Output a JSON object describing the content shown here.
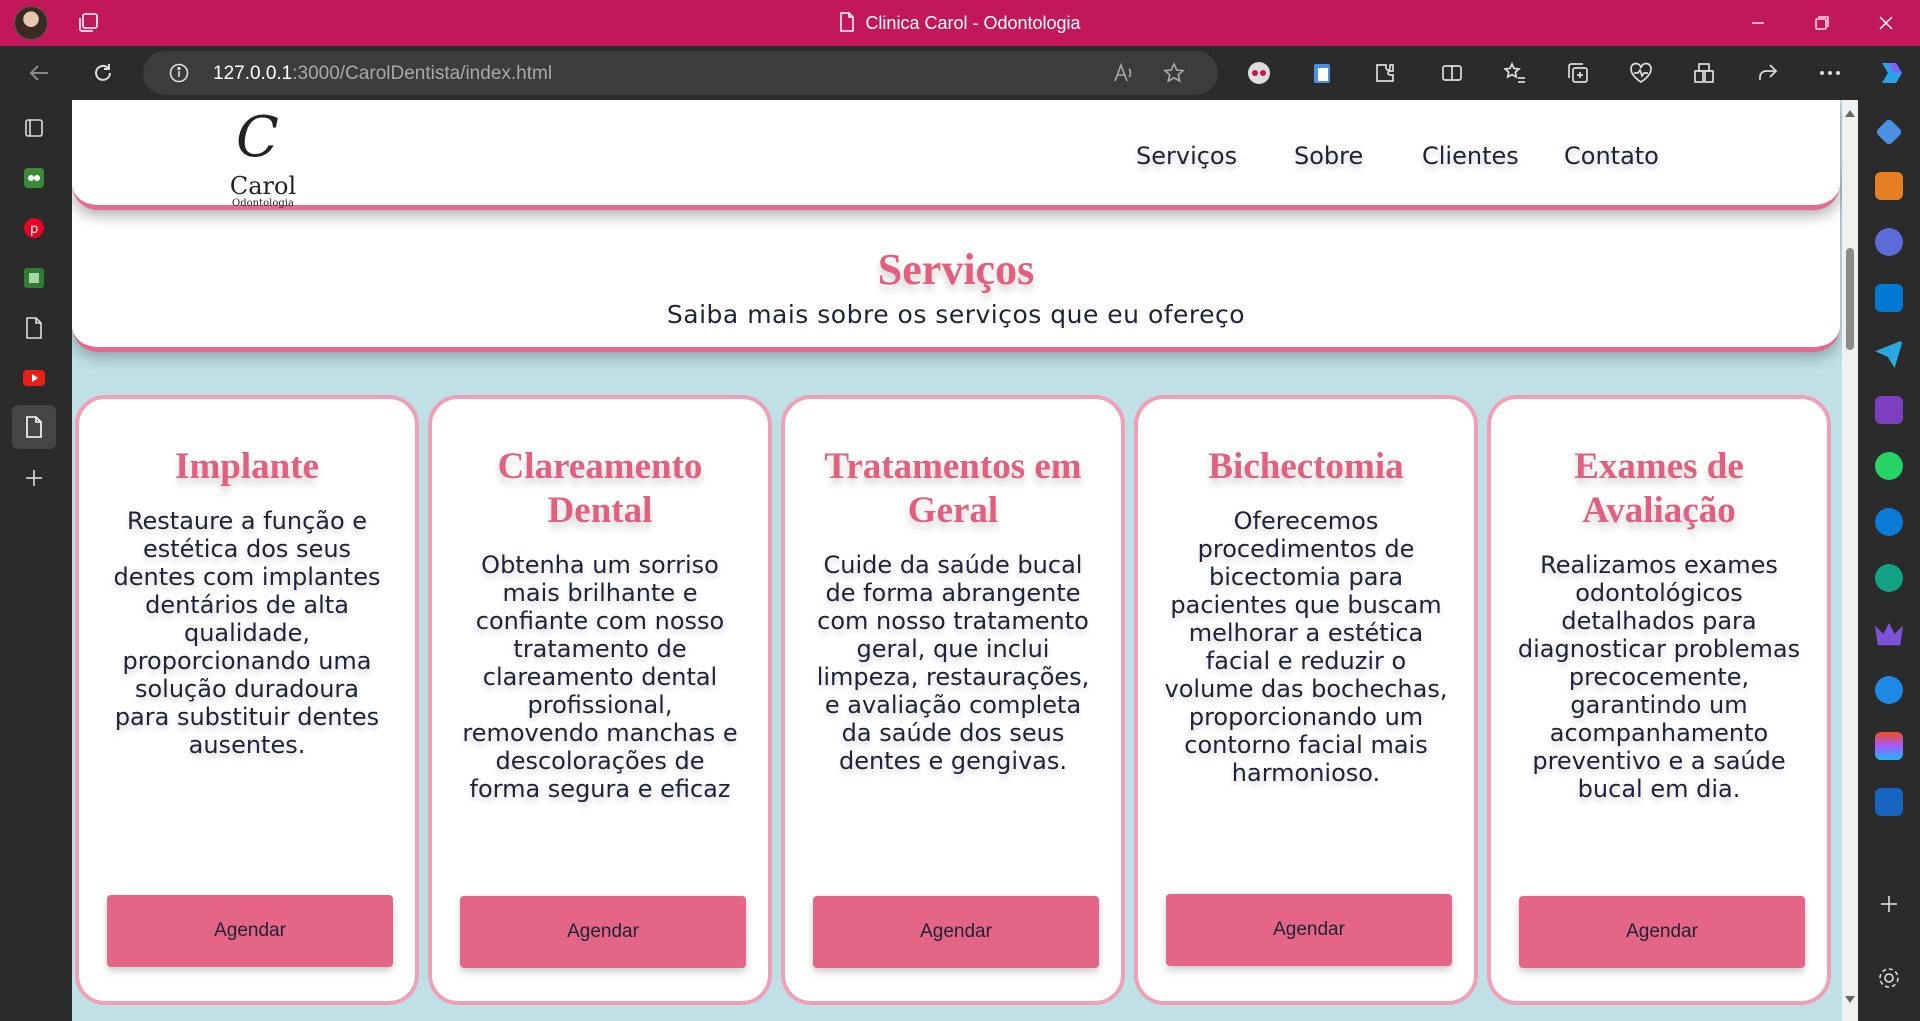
{
  "browser": {
    "window_title": "Clinica Carol - Odontologia",
    "url_host": "127.0.0.1",
    "url_rest": ":3000/CarolDentista/index.html",
    "accent_color": "#c2185b"
  },
  "site": {
    "logo": {
      "initial": "C",
      "name": "Carol",
      "subtitle": "Odontologia"
    },
    "nav": [
      "Serviços",
      "Sobre",
      "Clientes",
      "Contato"
    ],
    "section_title": "Serviços",
    "section_subtitle": "Saiba mais sobre os serviços que eu ofereço",
    "accent_color": "#e0607e",
    "cards": [
      {
        "title": "Implante",
        "text": "Restaure a função e estética dos seus dentes com implantes dentários de alta qualidade, proporcionando uma solução duradoura para substituir dentes ausentes.",
        "button": "Agendar"
      },
      {
        "title": "Clareamento Dental",
        "text": "Obtenha um sorriso mais brilhante e confiante com nosso tratamento de clareamento dental profissional, removendo manchas e descolorações de forma segura e eficaz",
        "button": "Agendar"
      },
      {
        "title": "Tratamentos em Geral",
        "text": "Cuide da saúde bucal de forma abrangente com nosso tratamento geral, que inclui limpeza, restaurações, e avaliação completa da saúde dos seus dentes e gengivas.",
        "button": "Agendar"
      },
      {
        "title": "Bichectomia",
        "text": "Oferecemos procedimentos de bicectomia para pacientes que buscam melhorar a estética facial e reduzir o volume das bochechas, proporcionando um contorno facial mais harmonioso.",
        "button": "Agendar"
      },
      {
        "title": "Exames de Avaliação",
        "text": "Realizamos exames odontológicos detalhados para diagnosticar problemas precocemente, garantindo um acompanhamento preventivo e a saúde bucal em dia.",
        "button": "Agendar"
      }
    ]
  }
}
